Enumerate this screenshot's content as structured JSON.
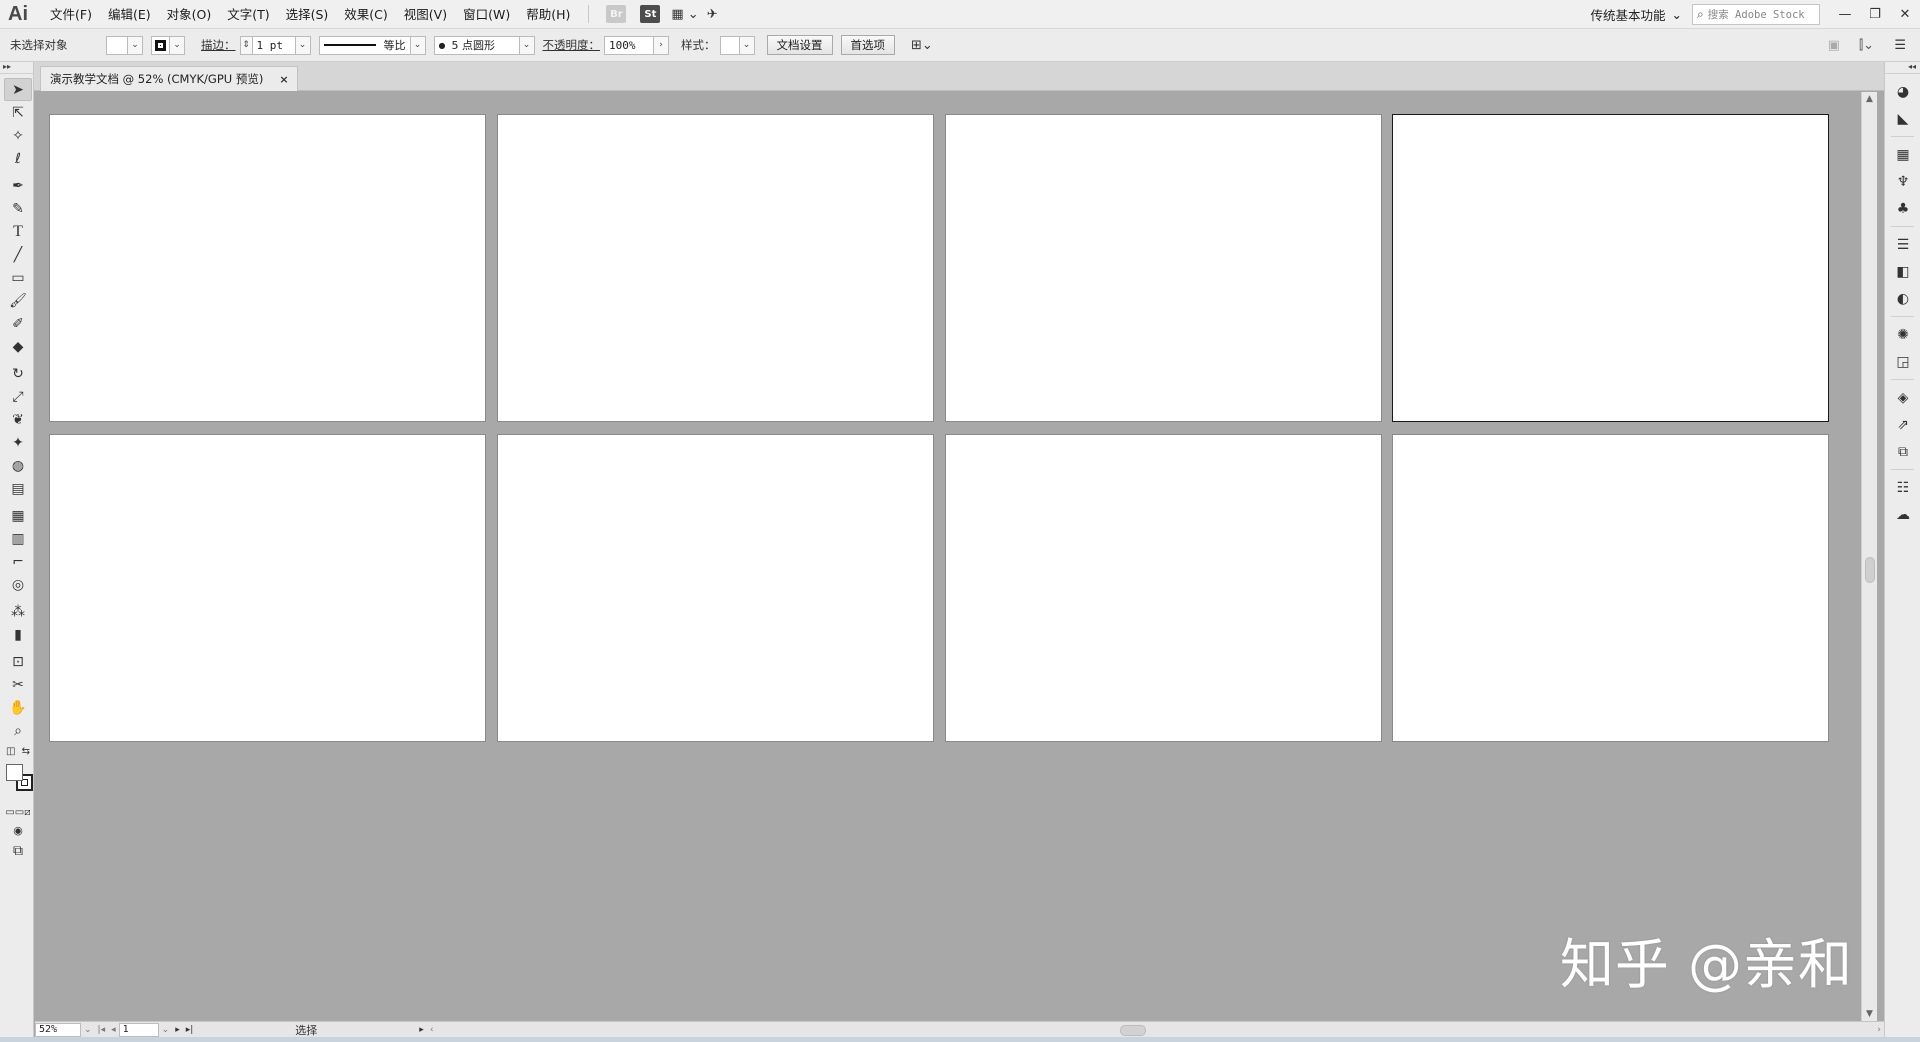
{
  "app": {
    "logo": "Ai"
  },
  "menu": {
    "items": [
      {
        "name": "menu-file",
        "label": "文件(F)"
      },
      {
        "name": "menu-edit",
        "label": "编辑(E)"
      },
      {
        "name": "menu-object",
        "label": "对象(O)"
      },
      {
        "name": "menu-type",
        "label": "文字(T)"
      },
      {
        "name": "menu-select",
        "label": "选择(S)"
      },
      {
        "name": "menu-effect",
        "label": "效果(C)"
      },
      {
        "name": "menu-view",
        "label": "视图(V)"
      },
      {
        "name": "menu-window",
        "label": "窗口(W)"
      },
      {
        "name": "menu-help",
        "label": "帮助(H)"
      }
    ],
    "bridge_label": "Br",
    "stock_label": "St"
  },
  "workspace": {
    "label": "传统基本功能"
  },
  "stock_search": {
    "placeholder": "搜索 Adobe Stock"
  },
  "controlbar": {
    "selection_status": "未选择对象",
    "stroke_label": "描边：",
    "stroke_weight": "1 pt",
    "stroke_profile": "等比",
    "brush_label": "5 点圆形",
    "opacity_label": "不透明度：",
    "opacity_value": "100%",
    "style_label": "样式：",
    "doc_setup_button": "文档设置",
    "preferences_button": "首选项"
  },
  "document_tab": {
    "title": "演示教学文档 @ 52% (CMYK/GPU 预览)",
    "close_glyph": "×"
  },
  "artboards": {
    "count": 8,
    "selected_index": 3
  },
  "statusbar": {
    "zoom": "52%",
    "artboard_number": "1",
    "status": "选择"
  },
  "watermark": {
    "text": "知乎 @亲和"
  },
  "colors": {
    "canvas_bg": "#a8a8a8",
    "artboard_fill": "#ffffff",
    "chrome_bg": "#ececec"
  }
}
